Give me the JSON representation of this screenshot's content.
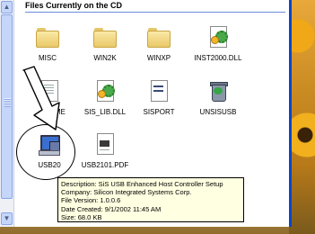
{
  "header": {
    "title": "Files Currently on the CD"
  },
  "scrollbar": {
    "up_glyph": "▲",
    "down_glyph": "▼"
  },
  "files": [
    {
      "name": "MISC",
      "icon": "folder-icon"
    },
    {
      "name": "WIN2K",
      "icon": "folder-icon"
    },
    {
      "name": "WINXP",
      "icon": "folder-icon"
    },
    {
      "name": "INST2000.DLL",
      "icon": "dll-file-icon"
    },
    {
      "name": "README",
      "visible_label": "DME",
      "icon": "text-document-icon"
    },
    {
      "name": "SIS_LIB.DLL",
      "icon": "dll-file-icon"
    },
    {
      "name": "SISPORT",
      "icon": "application-icon"
    },
    {
      "name": "UNSISUSB",
      "icon": "uninstall-icon"
    },
    {
      "name": "USB20",
      "icon": "setup-icon"
    },
    {
      "name": "USB2101.PDF",
      "icon": "pdf-document-icon"
    }
  ],
  "tooltip": {
    "description": "Description: SiS USB Enhanced Host Controller Setup",
    "company": "Company: Silicon Integrated Systems Corp.",
    "version": "File Version: 1.0.0.6",
    "date": "Date Created: 9/1/2002 11:45 AM",
    "size": "Size: 68.0 KB"
  }
}
